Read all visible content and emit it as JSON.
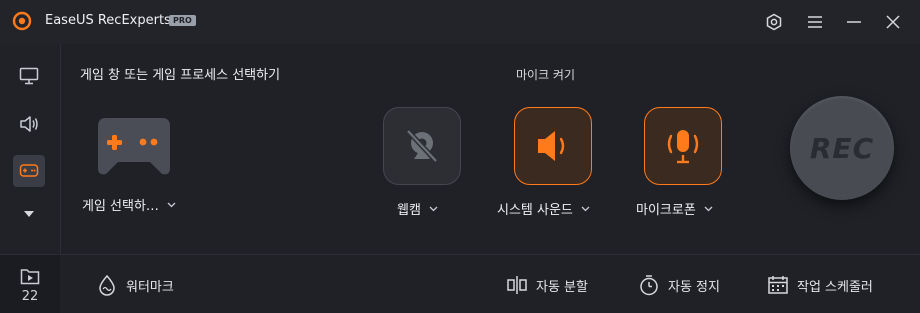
{
  "titlebar": {
    "app_title": "EaseUS RecExperts",
    "badge": "PRO"
  },
  "sidebar": {
    "items": [
      {
        "name": "screen",
        "icon": "monitor-icon"
      },
      {
        "name": "audio",
        "icon": "speaker-icon"
      },
      {
        "name": "game",
        "icon": "gamepad-icon",
        "active": true
      }
    ],
    "recordings_count": "22"
  },
  "main": {
    "game_section_title": "게임 창 또는 게임 프로세스 선택하기",
    "game_select_label": "게임 선택하…",
    "mic_section_title": "마이크 켜기",
    "webcam_label": "웹캠",
    "system_sound_label": "시스템 사운드",
    "microphone_label": "마이크로폰",
    "rec_label": "REC"
  },
  "bottombar": {
    "watermark": "워터마크",
    "auto_split": "자동 분할",
    "auto_stop": "자동 정지",
    "task_scheduler": "작업 스케줄러"
  },
  "colors": {
    "accent": "#ff7a1a",
    "background": "#1f2127"
  }
}
